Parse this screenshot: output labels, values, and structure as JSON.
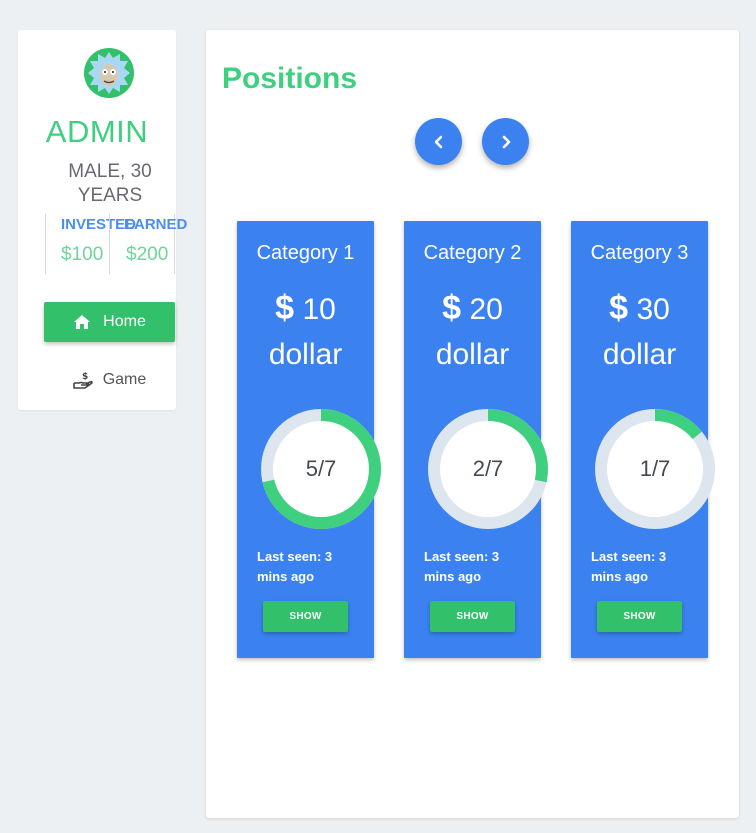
{
  "sidebar": {
    "user_name": "ADMIN",
    "user_info": "MALE, 30 YEARS",
    "stats": [
      {
        "label": "INVESTED",
        "value": "$100"
      },
      {
        "label": "EARNED",
        "value": "$200"
      }
    ],
    "nav": [
      {
        "label": "Home",
        "icon": "home-icon",
        "active": true
      },
      {
        "label": "Game",
        "icon": "hand-money-icon",
        "active": false
      }
    ]
  },
  "main": {
    "title": "Positions",
    "prev_icon": "chevron-left-icon",
    "next_icon": "chevron-right-icon"
  },
  "cards": [
    {
      "title": "Category 1",
      "currency_symbol": "$",
      "amount": "10",
      "unit": "dollar",
      "progress_text": "5/7",
      "progress": 0.7143,
      "last_seen": "Last seen: 3 mins ago",
      "button": "SHOW"
    },
    {
      "title": "Category 2",
      "currency_symbol": "$",
      "amount": "20",
      "unit": "dollar",
      "progress_text": "2/7",
      "progress": 0.2857,
      "last_seen": "Last seen: 3 mins ago",
      "button": "SHOW"
    },
    {
      "title": "Category 3",
      "currency_symbol": "$",
      "amount": "30",
      "unit": "dollar",
      "progress_text": "1/7",
      "progress": 0.1429,
      "last_seen": "Last seen: 3 mins ago",
      "button": "SHOW"
    }
  ],
  "colors": {
    "accent_green": "#3ecf7f",
    "button_green": "#33c06a",
    "card_blue": "#3b82f0",
    "ring_track": "#dde5ee",
    "ring_progress": "#3ecf7f"
  }
}
